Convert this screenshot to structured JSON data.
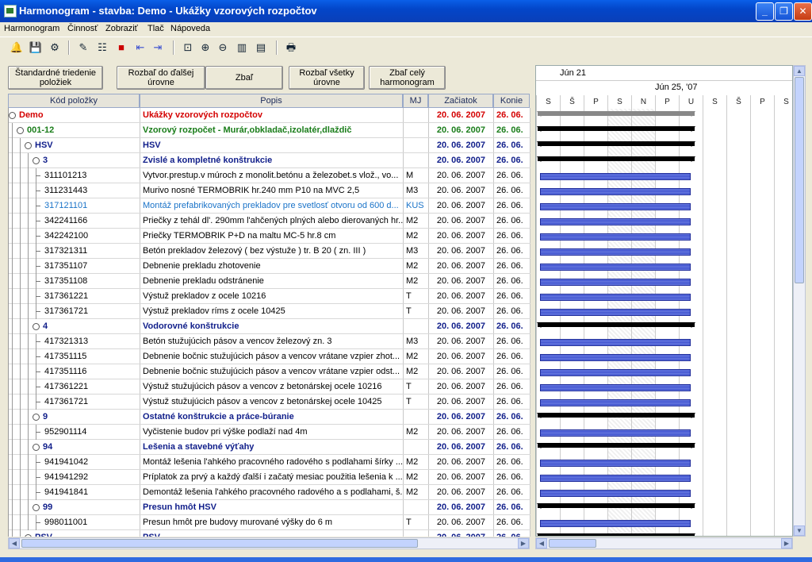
{
  "window": {
    "title": "Harmonogram - stavba: Demo - Ukážky vzorových rozpočtov"
  },
  "menu": [
    "Harmonogram",
    "Činnosť",
    "Zobraziť",
    "Tlač",
    "Nápoveda"
  ],
  "toolbar_icons": [
    "bell-icon",
    "save-icon",
    "settings-icon",
    "edit-icon",
    "tree-icon",
    "stop-icon",
    "indent-icon",
    "outdent-icon",
    "fit-icon",
    "zoom-in-icon",
    "zoom-out-icon",
    "columns-icon",
    "list-icon",
    "print-icon"
  ],
  "buttons": {
    "sort": "Štandardné triedenie položiek",
    "expand_next": "Rozbaľ do ďalšej úrovne",
    "collapse": "Zbaľ",
    "expand_all": "Rozbaľ všetky úrovne",
    "collapse_all": "Zbaľ celý harmonogram"
  },
  "columns": {
    "code": "Kód položky",
    "desc": "Popis",
    "unit": "MJ",
    "start": "Začiatok",
    "end": "Konie"
  },
  "gantt": {
    "month": "Jún 21",
    "week": "Jún 25, '07",
    "days": [
      "S",
      "Š",
      "P",
      "S",
      "N",
      "P",
      "U",
      "S",
      "Š",
      "P",
      "S"
    ]
  },
  "rows": [
    {
      "level": 0,
      "type": "root",
      "code": "Demo",
      "desc": "Ukážky vzorových rozpočtov",
      "unit": "",
      "start": "20. 06. 2007",
      "end": "26. 06."
    },
    {
      "level": 1,
      "type": "group",
      "code": "001-12",
      "desc": "Vzorový rozpočet - Murár,obkladač,izolatér,dlaždič",
      "unit": "",
      "start": "20. 06. 2007",
      "end": "26. 06."
    },
    {
      "level": 2,
      "type": "section",
      "code": "HSV",
      "desc": "HSV",
      "unit": "",
      "start": "20. 06. 2007",
      "end": "26. 06."
    },
    {
      "level": 3,
      "type": "section",
      "code": "3",
      "desc": "Zvislé a kompletné konštrukcie",
      "unit": "",
      "start": "20. 06. 2007",
      "end": "26. 06."
    },
    {
      "level": 4,
      "type": "item",
      "code": "311101213",
      "desc": "Vytvor.prestup.v múroch z monolit.betónu a železobet.s vlož., vo...",
      "unit": "M",
      "start": "20. 06. 2007",
      "end": "26. 06."
    },
    {
      "level": 4,
      "type": "item",
      "code": "311231443",
      "desc": "Murivo nosné TERMOBRIK hr.240 mm P10 na MVC 2,5",
      "unit": "M3",
      "start": "20. 06. 2007",
      "end": "26. 06."
    },
    {
      "level": 4,
      "type": "item-blue",
      "code": "317121101",
      "desc": "Montáž prefabrikovaných prekladov pre svetlosť otvoru od 600 d...",
      "unit": "KUS",
      "start": "20. 06. 2007",
      "end": "26. 06."
    },
    {
      "level": 4,
      "type": "item",
      "code": "342241166",
      "desc": "Priečky z tehál dl'. 290mm l'ahčených plných alebo dierovaných hr...",
      "unit": "M2",
      "start": "20. 06. 2007",
      "end": "26. 06."
    },
    {
      "level": 4,
      "type": "item",
      "code": "342242100",
      "desc": "Priečky TERMOBRIK P+D na maltu MC-5 hr.8 cm",
      "unit": "M2",
      "start": "20. 06. 2007",
      "end": "26. 06."
    },
    {
      "level": 4,
      "type": "item",
      "code": "317321311",
      "desc": "Betón prekladov železový ( bez výstuže ) tr. B 20 ( zn. III )",
      "unit": "M3",
      "start": "20. 06. 2007",
      "end": "26. 06."
    },
    {
      "level": 4,
      "type": "item",
      "code": "317351107",
      "desc": "Debnenie prekladu zhotovenie",
      "unit": "M2",
      "start": "20. 06. 2007",
      "end": "26. 06."
    },
    {
      "level": 4,
      "type": "item",
      "code": "317351108",
      "desc": "Debnenie prekladu odstránenie",
      "unit": "M2",
      "start": "20. 06. 2007",
      "end": "26. 06."
    },
    {
      "level": 4,
      "type": "item",
      "code": "317361221",
      "desc": "Výstuž prekladov z ocele 10216",
      "unit": "T",
      "start": "20. 06. 2007",
      "end": "26. 06."
    },
    {
      "level": 4,
      "type": "item",
      "code": "317361721",
      "desc": "Výstuž prekladov ríms z ocele 10425",
      "unit": "T",
      "start": "20. 06. 2007",
      "end": "26. 06."
    },
    {
      "level": 3,
      "type": "section",
      "code": "4",
      "desc": "Vodorovné konštrukcie",
      "unit": "",
      "start": "20. 06. 2007",
      "end": "26. 06."
    },
    {
      "level": 4,
      "type": "item",
      "code": "417321313",
      "desc": "Betón stužujúcich pásov a vencov železový zn. 3",
      "unit": "M3",
      "start": "20. 06. 2007",
      "end": "26. 06."
    },
    {
      "level": 4,
      "type": "item",
      "code": "417351115",
      "desc": "Debnenie bočnic stužujúcich pásov a vencov vrátane vzpier zhot...",
      "unit": "M2",
      "start": "20. 06. 2007",
      "end": "26. 06."
    },
    {
      "level": 4,
      "type": "item",
      "code": "417351116",
      "desc": "Debnenie bočnic stužujúcich pásov a vencov vrátane vzpier odst...",
      "unit": "M2",
      "start": "20. 06. 2007",
      "end": "26. 06."
    },
    {
      "level": 4,
      "type": "item",
      "code": "417361221",
      "desc": "Výstuž stužujúcich pásov a vencov z betonárskej ocele 10216",
      "unit": "T",
      "start": "20. 06. 2007",
      "end": "26. 06."
    },
    {
      "level": 4,
      "type": "item",
      "code": "417361721",
      "desc": "Výstuž stužujúcich pásov a vencov z betonárskej ocele 10425",
      "unit": "T",
      "start": "20. 06. 2007",
      "end": "26. 06."
    },
    {
      "level": 3,
      "type": "section",
      "code": "9",
      "desc": "Ostatné konštrukcie a práce-búranie",
      "unit": "",
      "start": "20. 06. 2007",
      "end": "26. 06."
    },
    {
      "level": 4,
      "type": "item",
      "code": "952901114",
      "desc": "Vyčistenie budov pri výške podlaží nad 4m",
      "unit": "M2",
      "start": "20. 06. 2007",
      "end": "26. 06."
    },
    {
      "level": 3,
      "type": "section",
      "code": "94",
      "desc": "Lešenia a stavebné výťahy",
      "unit": "",
      "start": "20. 06. 2007",
      "end": "26. 06."
    },
    {
      "level": 4,
      "type": "item",
      "code": "941941042",
      "desc": "Montáž lešenia l'ahkého pracovného radového s podlahami šírky ...",
      "unit": "M2",
      "start": "20. 06. 2007",
      "end": "26. 06."
    },
    {
      "level": 4,
      "type": "item",
      "code": "941941292",
      "desc": "Príplatok za prvý a každý ďalší i začatý mesiac použitia lešenia k ...",
      "unit": "M2",
      "start": "20. 06. 2007",
      "end": "26. 06."
    },
    {
      "level": 4,
      "type": "item",
      "code": "941941841",
      "desc": "Demontáž lešenia l'ahkého pracovného radového a s podlahami, š...",
      "unit": "M2",
      "start": "20. 06. 2007",
      "end": "26. 06."
    },
    {
      "level": 3,
      "type": "section",
      "code": "99",
      "desc": "Presun hmôt HSV",
      "unit": "",
      "start": "20. 06. 2007",
      "end": "26. 06."
    },
    {
      "level": 4,
      "type": "item",
      "code": "998011001",
      "desc": "Presun hmôt pre budovy murované výšky do 6 m",
      "unit": "T",
      "start": "20. 06. 2007",
      "end": "26. 06."
    },
    {
      "level": 2,
      "type": "section",
      "code": "PSV",
      "desc": "PSV",
      "unit": "",
      "start": "20. 06. 2007",
      "end": "26. 06."
    }
  ]
}
